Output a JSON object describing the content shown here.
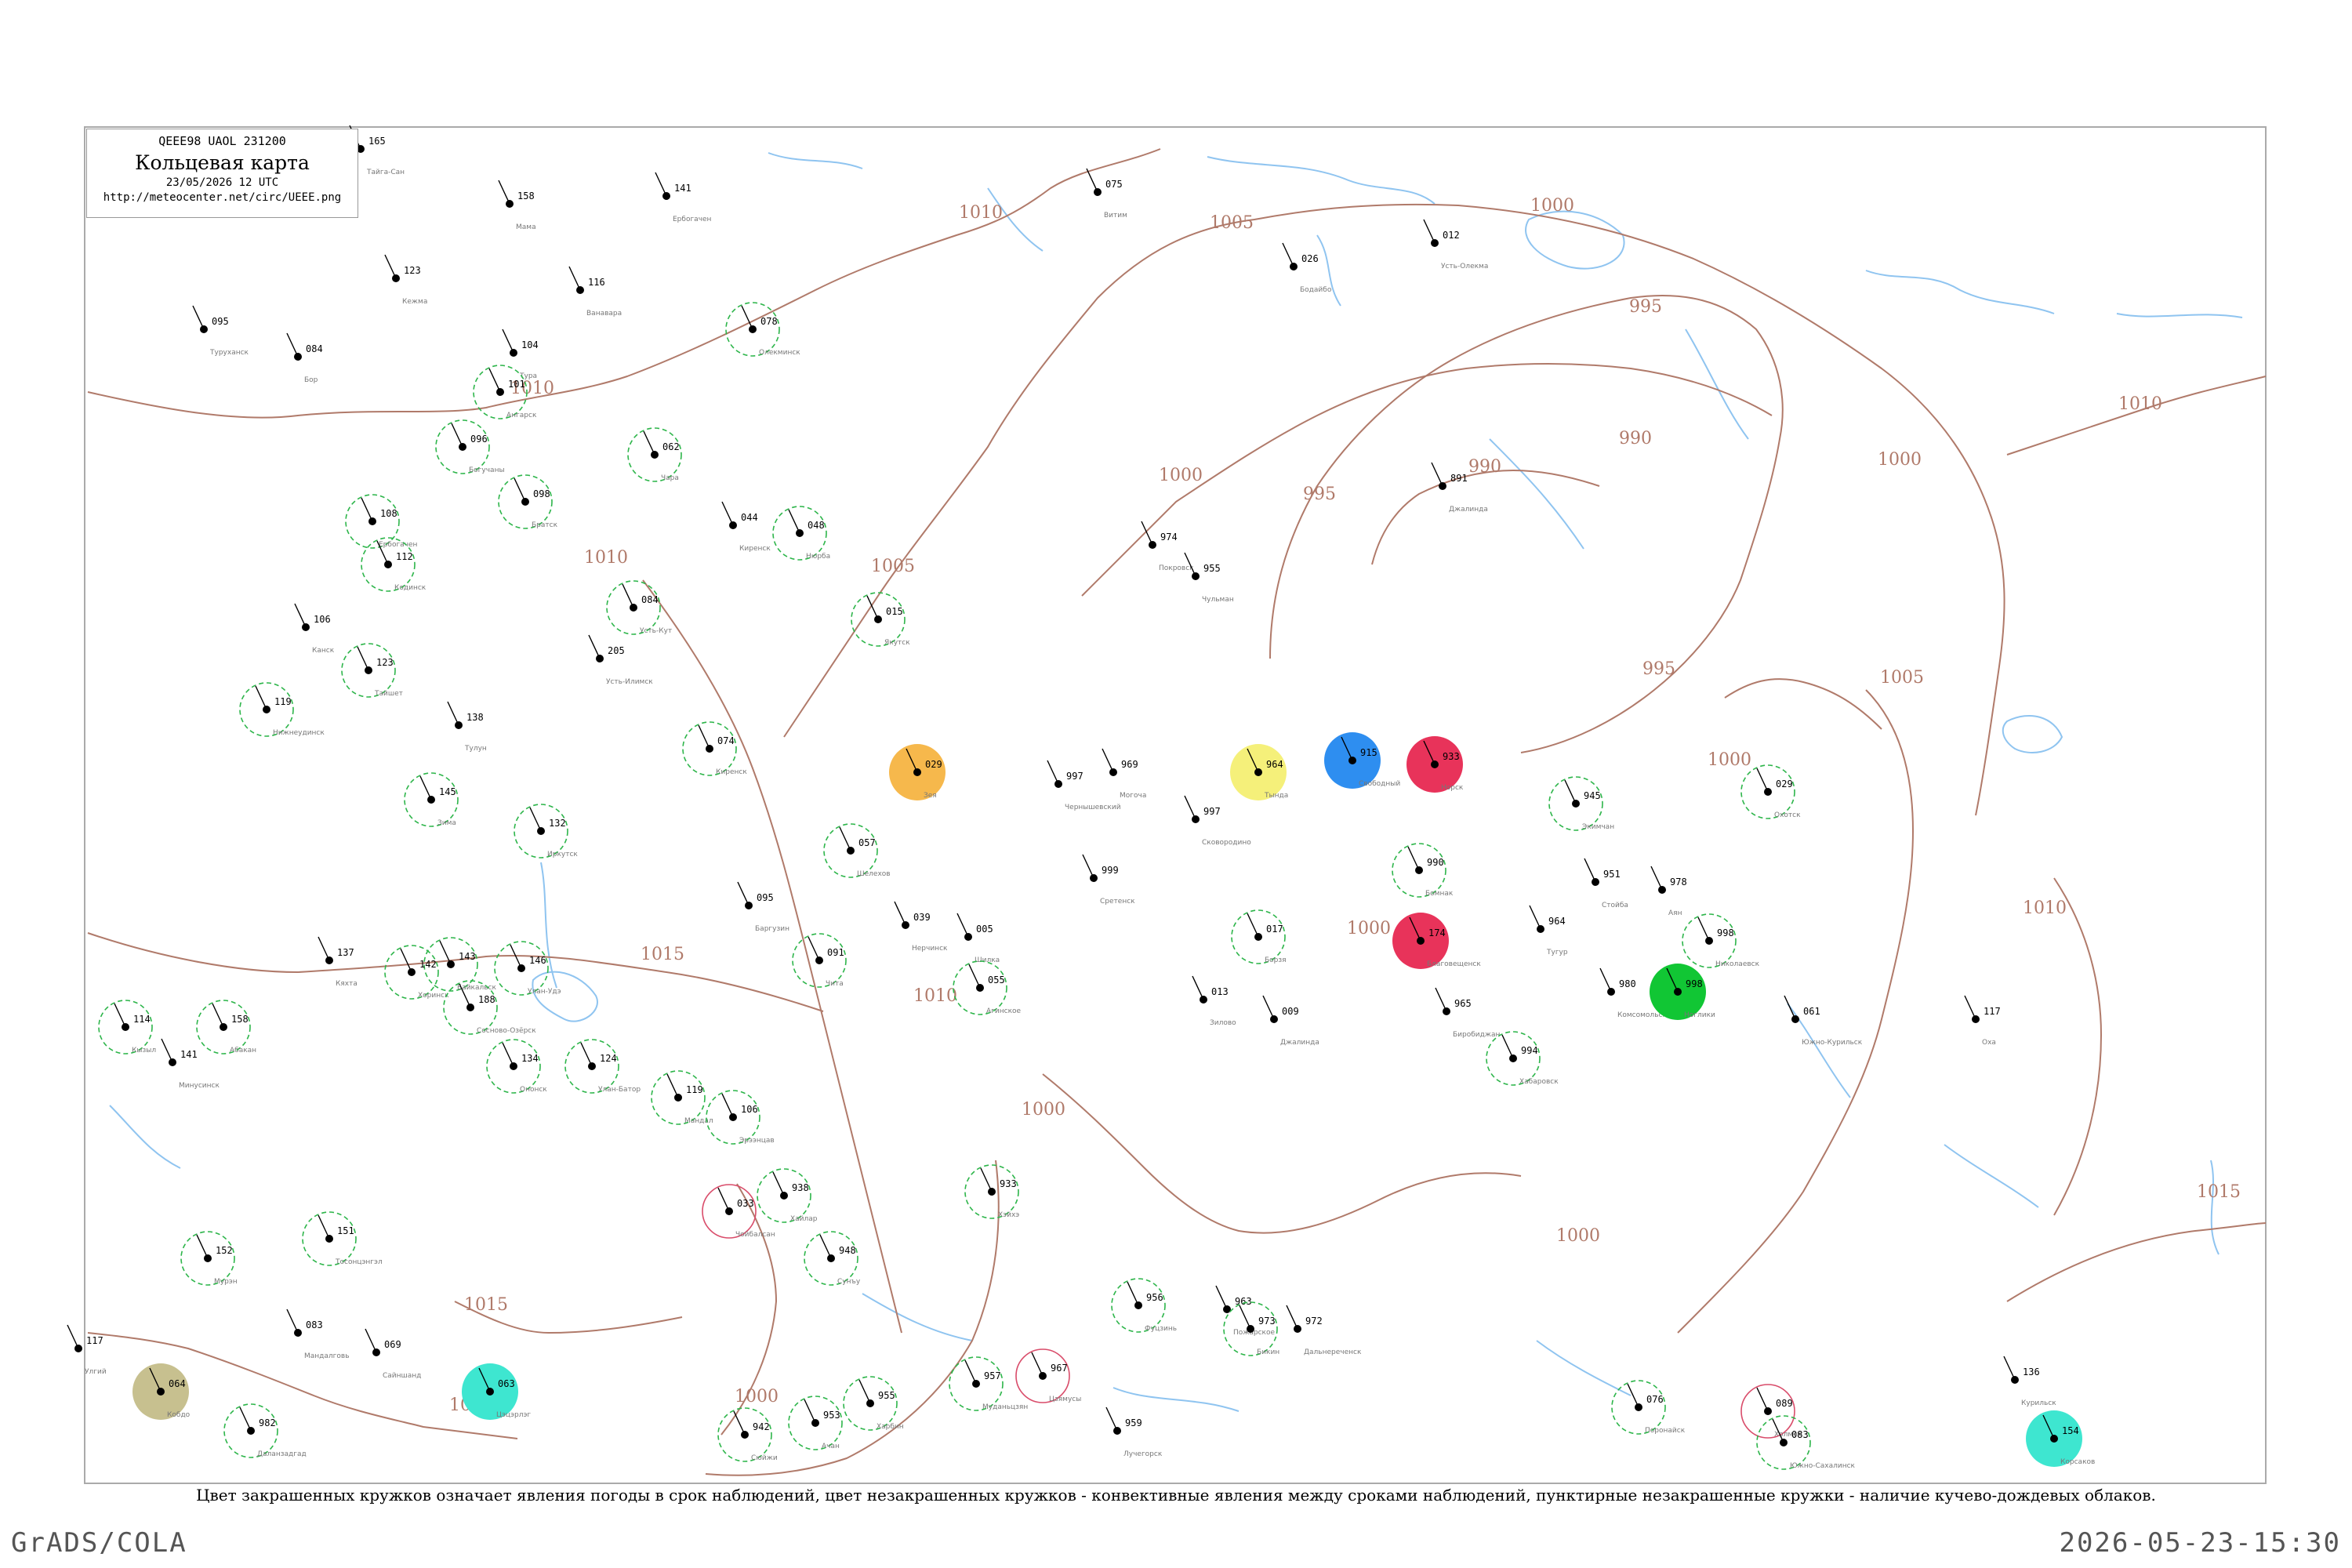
{
  "header": {
    "code_line": "QEEE98  UAOL  231200",
    "title": "Кольцевая карта",
    "date_line": "23/05/2026 12 UTC",
    "url": "http://meteocenter.net/circ/UEEE.png"
  },
  "caption": "Цвет закрашенных кружков означает явления погоды в срок наблюдений, цвет незакрашенных кружков - конвективные явления между сроками наблюдений, пунктирные незакрашенные кружки - наличие кучево-дождевых облаков.",
  "footer": {
    "left": "GrADS/COLA",
    "right": "2026-05-23-15:30"
  },
  "colors": {
    "isobar": "#b07a6a",
    "water": "#8fc4f0",
    "frame": "#aaaaaa",
    "green": "#11c634",
    "blue": "#2e8ef0",
    "red": "#e8335a",
    "orange": "#f6b84c",
    "olive": "#c7c08f",
    "cyan": "#3ee6d0",
    "yellow": "#f5f07a",
    "dash_ring": "#2db54a",
    "convective_ring": "#d94c6a"
  },
  "isobar_labels": [
    "1000",
    "1005",
    "1010",
    "1015",
    "995",
    "990"
  ],
  "stations": [
    {
      "p": "165",
      "n": "Тайга-Сан",
      "s": "none"
    },
    {
      "p": "158",
      "n": "Мама",
      "s": "none"
    },
    {
      "p": "141",
      "n": "Ербогачен",
      "s": "none"
    },
    {
      "p": "075",
      "n": "Витим",
      "s": "none"
    },
    {
      "p": "026",
      "n": "Бодайбо",
      "s": "none"
    },
    {
      "p": "012",
      "n": "Усть-Олекма",
      "s": "none"
    },
    {
      "p": "095",
      "n": "Туруханск",
      "s": "none"
    },
    {
      "p": "084",
      "n": "Бор",
      "s": "none"
    },
    {
      "p": "123",
      "n": "Кежма",
      "s": "none"
    },
    {
      "p": "116",
      "n": "Ванавара",
      "s": "none"
    },
    {
      "p": "078",
      "n": "Олекминск",
      "s": "dashed"
    },
    {
      "p": "104",
      "n": "Тура",
      "s": "none"
    },
    {
      "p": "101",
      "n": "Ангарск",
      "s": "dashed"
    },
    {
      "p": "096",
      "n": "Богучаны",
      "s": "dashed"
    },
    {
      "p": "062",
      "n": "Чара",
      "s": "dashed"
    },
    {
      "p": "044",
      "n": "Киренск",
      "s": "none"
    },
    {
      "p": "048",
      "n": "Нюрба",
      "s": "dashed"
    },
    {
      "p": "015",
      "n": "Якутск",
      "s": "dashed"
    },
    {
      "p": "974",
      "n": "Покровск",
      "s": "none"
    },
    {
      "p": "955",
      "n": "Чульман",
      "s": "none"
    },
    {
      "p": "891",
      "n": "Джалинда",
      "s": "none"
    },
    {
      "p": "108",
      "n": "Ербогачен",
      "s": "dashed"
    },
    {
      "p": "112",
      "n": "Кодинск",
      "s": "dashed"
    },
    {
      "p": "098",
      "n": "Братск",
      "s": "dashed"
    },
    {
      "p": "084",
      "n": "Усть-Кут",
      "s": "dashed"
    },
    {
      "p": "205",
      "n": "Усть-Илимск",
      "s": "none"
    },
    {
      "p": "106",
      "n": "Канск",
      "s": "none"
    },
    {
      "p": "123",
      "n": "Тайшет",
      "s": "dashed"
    },
    {
      "p": "138",
      "n": "Тулун",
      "s": "none"
    },
    {
      "p": "119",
      "n": "Нижнеудинск",
      "s": "dashed"
    },
    {
      "p": "074",
      "n": "Киренск",
      "s": "dashed"
    },
    {
      "p": "029",
      "n": "Зея",
      "s": "filled"
    },
    {
      "p": "997",
      "n": "Чернышевский",
      "s": "none"
    },
    {
      "p": "969",
      "n": "Могоча",
      "s": "none"
    },
    {
      "p": "964",
      "n": "Тында",
      "s": "filled"
    },
    {
      "p": "997",
      "n": "Сковородино",
      "s": "none"
    },
    {
      "p": "915",
      "n": "Свободный",
      "s": "filled"
    },
    {
      "p": "933",
      "n": "Норск",
      "s": "filled"
    },
    {
      "p": "945",
      "n": "Экимчан",
      "s": "dashed"
    },
    {
      "p": "029",
      "n": "Охотск",
      "s": "dashed"
    },
    {
      "p": "145",
      "n": "Зима",
      "s": "dashed"
    },
    {
      "p": "132",
      "n": "Иркутск",
      "s": "dashed"
    },
    {
      "p": "057",
      "n": "Шелехов",
      "s": "dashed"
    },
    {
      "p": "999",
      "n": "Сретенск",
      "s": "none"
    },
    {
      "p": "990",
      "n": "Бомнак",
      "s": "dashed"
    },
    {
      "p": "951",
      "n": "Стойба",
      "s": "none"
    },
    {
      "p": "978",
      "n": "Аян",
      "s": "none"
    },
    {
      "p": "095",
      "n": "Баргузин",
      "s": "none"
    },
    {
      "p": "039",
      "n": "Нерчинск",
      "s": "none"
    },
    {
      "p": "005",
      "n": "Шилка",
      "s": "none"
    },
    {
      "p": "017",
      "n": "Борзя",
      "s": "dashed"
    },
    {
      "p": "174",
      "n": "Благовещенск",
      "s": "filled"
    },
    {
      "p": "964",
      "n": "Тугур",
      "s": "none"
    },
    {
      "p": "998",
      "n": "Николаевск",
      "s": "dashed"
    },
    {
      "p": "143",
      "n": "Байкальск",
      "s": "dashed"
    },
    {
      "p": "146",
      "n": "Улан-Удэ",
      "s": "dashed"
    },
    {
      "p": "091",
      "n": "Чита",
      "s": "dashed"
    },
    {
      "p": "055",
      "n": "Агинское",
      "s": "dashed"
    },
    {
      "p": "013",
      "n": "Зилово",
      "s": "none"
    },
    {
      "p": "009",
      "n": "Джалинда",
      "s": "none"
    },
    {
      "p": "965",
      "n": "Биробиджан",
      "s": "none"
    },
    {
      "p": "994",
      "n": "Хабаровск",
      "s": "dashed"
    },
    {
      "p": "980",
      "n": "Комсомольск",
      "s": "none"
    },
    {
      "p": "998",
      "n": "Ноглики",
      "s": "filled"
    },
    {
      "p": "061",
      "n": "Южно-Курильск",
      "s": "none"
    },
    {
      "p": "117",
      "n": "Оха",
      "s": "none"
    },
    {
      "p": "114",
      "n": "Кызыл",
      "s": "dashed"
    },
    {
      "p": "158",
      "n": "Абакан",
      "s": "dashed"
    },
    {
      "p": "141",
      "n": "Минусинск",
      "s": "none"
    },
    {
      "p": "137",
      "n": "Кяхта",
      "s": "none"
    },
    {
      "p": "142",
      "n": "Хоринск",
      "s": "dashed"
    },
    {
      "p": "188",
      "n": "Сосново-Озёрск",
      "s": "dashed"
    },
    {
      "p": "134",
      "n": "Ононск",
      "s": "dashed"
    },
    {
      "p": "124",
      "n": "Улан-Батор",
      "s": "dashed"
    },
    {
      "p": "119",
      "n": "Мандал",
      "s": "dashed"
    },
    {
      "p": "106",
      "n": "Эрээнцав",
      "s": "dashed"
    },
    {
      "p": "033",
      "n": "Чойбалсан",
      "s": "convective"
    },
    {
      "p": "938",
      "n": "Хайлар",
      "s": "dashed"
    },
    {
      "p": "933",
      "n": "Хэйхэ",
      "s": "dashed"
    },
    {
      "p": "948",
      "n": "Сунъу",
      "s": "dashed"
    },
    {
      "p": "967",
      "n": "Цзямусы",
      "s": "convective"
    },
    {
      "p": "956",
      "n": "Фуцзинь",
      "s": "dashed"
    },
    {
      "p": "963",
      "n": "Пожарское",
      "s": "none"
    },
    {
      "p": "973",
      "n": "Бикин",
      "s": "dashed"
    },
    {
      "p": "972",
      "n": "Дальнереченск",
      "s": "none"
    },
    {
      "p": "959",
      "n": "Лучегорск",
      "s": "none"
    },
    {
      "p": "076",
      "n": "Поронайск",
      "s": "dashed"
    },
    {
      "p": "089",
      "n": "Холмск",
      "s": "convective"
    },
    {
      "p": "083",
      "n": "Южно-Сахалинск",
      "s": "dashed"
    },
    {
      "p": "154",
      "n": "Корсаков",
      "s": "filled"
    },
    {
      "p": "136",
      "n": "Курильск",
      "s": "none"
    },
    {
      "p": "942",
      "n": "Сюйжи",
      "s": "dashed"
    },
    {
      "p": "953",
      "n": "Ачан",
      "s": "dashed"
    },
    {
      "p": "955",
      "n": "Харбин",
      "s": "dashed"
    },
    {
      "p": "957",
      "n": "Муданьцзян",
      "s": "dashed"
    },
    {
      "p": "064",
      "n": "Кобдо",
      "s": "filled"
    },
    {
      "p": "063",
      "n": "Цэцэрлэг",
      "s": "filled"
    },
    {
      "p": "982",
      "n": "Даланзадгад",
      "s": "dashed"
    },
    {
      "p": "069",
      "n": "Сайншанд",
      "s": "none"
    },
    {
      "p": "083",
      "n": "Мандалговь",
      "s": "none"
    },
    {
      "p": "117",
      "n": "Улгий",
      "s": "none"
    },
    {
      "p": "152",
      "n": "Мурэн",
      "s": "dashed"
    },
    {
      "p": "151",
      "n": "Тосонцэнгэл",
      "s": "dashed"
    }
  ]
}
